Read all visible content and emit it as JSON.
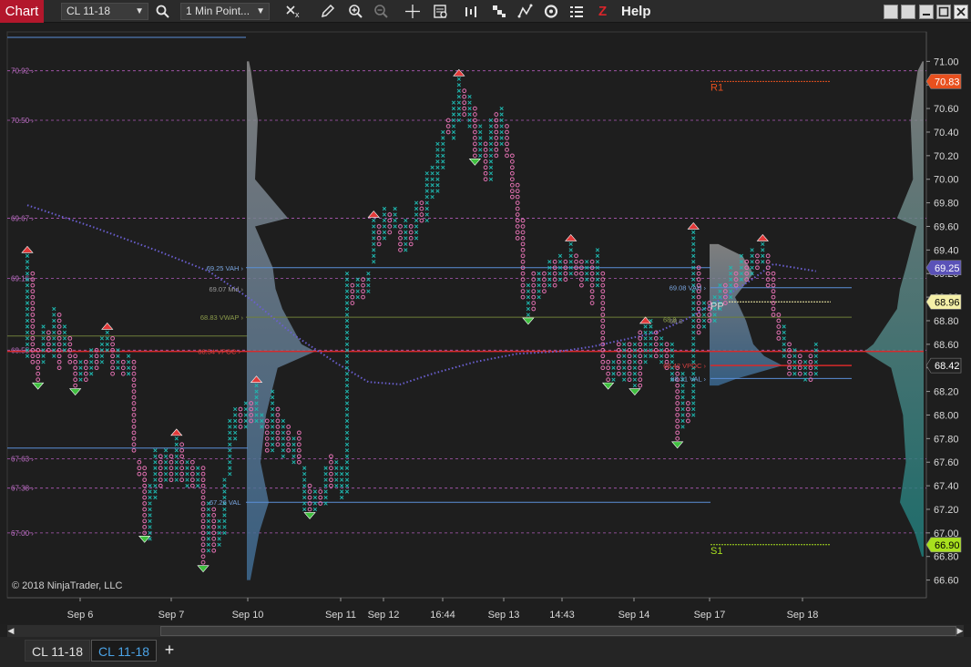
{
  "toolbar": {
    "chart_tab": "Chart",
    "instrument": "CL 11-18",
    "interval": "1 Min Point...",
    "help_z": "Z",
    "help": "Help"
  },
  "icons": [
    "search-icon",
    "data-series-icon",
    "pencil-icon",
    "zoom-in-icon",
    "zoom-out-icon",
    "crosshair-icon",
    "properties-icon",
    "bar-type-icon",
    "chart-style-icon",
    "drawing-tool-icon",
    "refresh-icon",
    "strategies-icon"
  ],
  "copyright": "© 2018 NinjaTrader, LLC",
  "tabs": [
    "CL 11-18",
    "CL 11-18"
  ],
  "add_tab": "+",
  "colors": {
    "up_x": "#1fb8b0",
    "down_o": "#e070b0",
    "vwap": "#6a5fd0",
    "value_line": "#5b8fd8",
    "poc": "#d82a2a",
    "pivot_dash": "#b05ab8",
    "r1": "#e8501e",
    "s1": "#a8e01e"
  },
  "chart_data": {
    "type": "point-and-figure",
    "instrument": "CL 11-18",
    "y_axis": {
      "range": [
        66.45,
        71.25
      ],
      "ticks": [
        "71.00",
        "70.80",
        "70.60",
        "70.40",
        "70.20",
        "70.00",
        "69.80",
        "69.60",
        "69.40",
        "69.20",
        "69.00",
        "68.80",
        "68.60",
        "68.40",
        "68.20",
        "68.00",
        "67.80",
        "67.60",
        "67.40",
        "67.20",
        "67.00",
        "66.80",
        "66.60"
      ]
    },
    "x_axis_labels": [
      "Sep 6",
      "Sep 7",
      "Sep 10",
      "Sep 11",
      "Sep 12",
      "16:44",
      "Sep 13",
      "14:43",
      "Sep 14",
      "Sep 17",
      "Sep 18"
    ],
    "price_markers": [
      {
        "label": "70.83",
        "value": 70.83,
        "bg": "#e8501e",
        "fg": "#ffffff"
      },
      {
        "label": "69.25",
        "value": 69.25,
        "bg": "#5a52b8",
        "fg": "#ffffff"
      },
      {
        "label": "68.96",
        "value": 68.96,
        "bg": "#f5f0a8",
        "fg": "#000000"
      },
      {
        "label": "68.42",
        "value": 68.42,
        "bg": "#202020",
        "fg": "#ffffff"
      },
      {
        "label": "66.90",
        "value": 66.9,
        "bg": "#a8e01e",
        "fg": "#000000"
      }
    ],
    "pivot_levels": [
      {
        "label": "70.92",
        "value": 70.92
      },
      {
        "label": "70.50",
        "value": 70.5
      },
      {
        "label": "69.67",
        "value": 69.67
      },
      {
        "label": "69.16",
        "value": 69.16
      },
      {
        "label": "68.55",
        "value": 68.55
      },
      {
        "label": "67.63",
        "value": 67.63
      },
      {
        "label": "67.38",
        "value": 67.38
      },
      {
        "label": "67.00",
        "value": 67.0
      }
    ],
    "pivot_tags": [
      {
        "label": "R1",
        "value": 70.83
      },
      {
        "label": "PP",
        "value": 68.96
      },
      {
        "label": "S1",
        "value": 66.9
      }
    ],
    "profile_labels": [
      {
        "label": "69.25 VAH",
        "value": 69.25
      },
      {
        "label": "69.07 Mid",
        "value": 69.07
      },
      {
        "label": "68.83 VWAP",
        "value": 68.83
      },
      {
        "label": "68.54 VPOC",
        "value": 68.54
      },
      {
        "label": "67.26 VAL",
        "value": 67.26
      },
      {
        "label": "69.08 VAH",
        "value": 69.08
      },
      {
        "label": "68.8",
        "value": 68.8
      },
      {
        "label": "68.8",
        "value": 68.81
      },
      {
        "label": "68.42 VPOC",
        "value": 68.42
      },
      {
        "label": "68.31 VAL",
        "value": 68.31
      }
    ],
    "pnf_columns": [
      [
        0,
        "X",
        68.5,
        69.35
      ],
      [
        1,
        "O",
        68.45,
        69.2
      ],
      [
        2,
        "O",
        68.3,
        68.55
      ],
      [
        3,
        "X",
        68.45,
        68.75
      ],
      [
        4,
        "O",
        68.55,
        68.7
      ],
      [
        5,
        "X",
        68.5,
        68.9
      ],
      [
        6,
        "O",
        68.4,
        68.85
      ],
      [
        7,
        "X",
        68.55,
        68.75
      ],
      [
        8,
        "O",
        68.45,
        68.65
      ],
      [
        9,
        "O",
        68.25,
        68.5
      ],
      [
        10,
        "X",
        68.3,
        68.45
      ],
      [
        11,
        "O",
        68.3,
        68.45
      ],
      [
        12,
        "X",
        68.35,
        68.55
      ],
      [
        13,
        "O",
        68.4,
        68.55
      ],
      [
        14,
        "X",
        68.45,
        68.65
      ],
      [
        15,
        "X",
        68.55,
        68.7
      ],
      [
        16,
        "O",
        68.35,
        68.65
      ],
      [
        17,
        "X",
        68.4,
        68.55
      ],
      [
        18,
        "O",
        68.35,
        68.45
      ],
      [
        19,
        "X",
        68.35,
        68.5
      ],
      [
        20,
        "O",
        67.7,
        68.45
      ],
      [
        21,
        "O",
        67.5,
        67.6
      ],
      [
        22,
        "O",
        67.0,
        67.55
      ],
      [
        23,
        "X",
        66.95,
        67.4
      ],
      [
        24,
        "X",
        67.3,
        67.7
      ],
      [
        25,
        "O",
        67.4,
        67.65
      ],
      [
        26,
        "X",
        67.45,
        67.7
      ],
      [
        27,
        "O",
        67.45,
        67.65
      ],
      [
        28,
        "X",
        67.45,
        67.8
      ],
      [
        29,
        "O",
        67.45,
        67.75
      ],
      [
        30,
        "X",
        67.4,
        67.6
      ],
      [
        31,
        "O",
        67.4,
        67.6
      ],
      [
        32,
        "X",
        67.4,
        67.55
      ],
      [
        33,
        "O",
        66.75,
        67.55
      ],
      [
        34,
        "X",
        66.85,
        67.25
      ],
      [
        35,
        "O",
        66.85,
        67.2
      ],
      [
        36,
        "X",
        66.9,
        67.1
      ],
      [
        37,
        "X",
        67.0,
        67.45
      ],
      [
        38,
        "X",
        67.5,
        67.95
      ],
      [
        39,
        "X",
        67.8,
        68.05
      ],
      [
        40,
        "O",
        67.9,
        68.05
      ],
      [
        41,
        "X",
        67.9,
        68.1
      ],
      [
        42,
        "O",
        67.95,
        68.1
      ],
      [
        43,
        "X",
        67.95,
        68.25
      ],
      [
        44,
        "X",
        67.9,
        68.0
      ],
      [
        45,
        "O",
        67.7,
        67.95
      ],
      [
        46,
        "X",
        67.7,
        68.2
      ],
      [
        47,
        "O",
        67.75,
        68.05
      ],
      [
        48,
        "X",
        67.65,
        67.95
      ],
      [
        49,
        "O",
        67.7,
        67.9
      ],
      [
        50,
        "X",
        67.6,
        67.8
      ],
      [
        51,
        "O",
        67.6,
        67.85
      ],
      [
        52,
        "X",
        67.2,
        67.55
      ],
      [
        53,
        "O",
        67.2,
        67.4
      ],
      [
        54,
        "X",
        67.2,
        67.35
      ],
      [
        55,
        "O",
        67.25,
        67.35
      ],
      [
        56,
        "X",
        67.25,
        67.55
      ],
      [
        57,
        "O",
        67.4,
        67.65
      ],
      [
        58,
        "X",
        67.4,
        67.6
      ],
      [
        59,
        "X",
        67.3,
        67.55
      ],
      [
        60,
        "X",
        67.35,
        69.2
      ],
      [
        61,
        "O",
        68.95,
        69.1
      ],
      [
        62,
        "X",
        69.0,
        69.15
      ],
      [
        63,
        "O",
        69.0,
        69.15
      ],
      [
        64,
        "X",
        69.05,
        69.2
      ],
      [
        65,
        "X",
        69.3,
        69.65
      ],
      [
        66,
        "O",
        69.45,
        69.6
      ],
      [
        67,
        "X",
        69.5,
        69.75
      ],
      [
        68,
        "O",
        69.55,
        69.7
      ],
      [
        69,
        "X",
        69.6,
        69.75
      ],
      [
        70,
        "O",
        69.4,
        69.6
      ],
      [
        71,
        "X",
        69.4,
        69.65
      ],
      [
        72,
        "O",
        69.45,
        69.6
      ],
      [
        73,
        "X",
        69.5,
        69.8
      ],
      [
        74,
        "O",
        69.65,
        69.8
      ],
      [
        75,
        "X",
        69.65,
        70.05
      ],
      [
        76,
        "X",
        69.85,
        70.1
      ],
      [
        77,
        "X",
        69.9,
        70.3
      ],
      [
        78,
        "X",
        70.1,
        70.4
      ],
      [
        79,
        "O",
        70.4,
        70.5
      ],
      [
        80,
        "X",
        70.35,
        70.65
      ],
      [
        81,
        "X",
        70.5,
        70.85
      ],
      [
        82,
        "O",
        70.55,
        70.75
      ],
      [
        83,
        "X",
        70.45,
        70.7
      ],
      [
        84,
        "O",
        70.2,
        70.6
      ],
      [
        85,
        "X",
        70.2,
        70.45
      ],
      [
        86,
        "O",
        70.0,
        70.3
      ],
      [
        87,
        "X",
        70.0,
        70.5
      ],
      [
        88,
        "O",
        70.2,
        70.55
      ],
      [
        89,
        "X",
        70.3,
        70.6
      ],
      [
        90,
        "O",
        70.2,
        70.45
      ],
      [
        91,
        "O",
        69.85,
        70.2
      ],
      [
        92,
        "O",
        69.5,
        69.95
      ],
      [
        93,
        "O",
        69.0,
        69.65
      ],
      [
        94,
        "X",
        68.85,
        69.1
      ],
      [
        95,
        "O",
        68.9,
        69.2
      ],
      [
        96,
        "X",
        69.0,
        69.2
      ],
      [
        97,
        "O",
        69.05,
        69.2
      ],
      [
        98,
        "X",
        69.1,
        69.3
      ],
      [
        99,
        "O",
        69.1,
        69.3
      ],
      [
        100,
        "X",
        69.15,
        69.35
      ],
      [
        101,
        "O",
        69.15,
        69.3
      ],
      [
        102,
        "X",
        69.2,
        69.45
      ],
      [
        103,
        "O",
        69.2,
        69.35
      ],
      [
        104,
        "O",
        69.1,
        69.3
      ],
      [
        105,
        "X",
        69.15,
        69.3
      ],
      [
        106,
        "O",
        68.95,
        69.3
      ],
      [
        107,
        "X",
        69.1,
        69.4
      ],
      [
        108,
        "O",
        68.4,
        69.2
      ],
      [
        109,
        "O",
        68.3,
        68.45
      ],
      [
        110,
        "X",
        68.3,
        68.45
      ],
      [
        111,
        "O",
        68.35,
        68.6
      ],
      [
        112,
        "X",
        68.3,
        68.6
      ],
      [
        113,
        "O",
        68.3,
        68.6
      ],
      [
        114,
        "X",
        68.25,
        68.6
      ],
      [
        115,
        "O",
        68.25,
        68.7
      ],
      [
        116,
        "X",
        68.45,
        68.75
      ],
      [
        117,
        "X",
        68.5,
        68.8
      ],
      [
        118,
        "O",
        68.5,
        68.7
      ],
      [
        119,
        "X",
        68.45,
        68.65
      ],
      [
        120,
        "O",
        68.4,
        68.6
      ],
      [
        121,
        "X",
        68.3,
        68.6
      ],
      [
        122,
        "O",
        67.8,
        68.4
      ],
      [
        123,
        "X",
        67.9,
        68.35
      ],
      [
        124,
        "O",
        67.95,
        68.1
      ],
      [
        125,
        "X",
        68.0,
        69.55
      ],
      [
        126,
        "O",
        68.7,
        69.25
      ],
      [
        127,
        "X",
        68.75,
        68.95
      ],
      [
        128,
        "O",
        68.8,
        68.95
      ],
      [
        129,
        "X",
        68.8,
        69.0
      ],
      [
        130,
        "X",
        68.9,
        69.1
      ],
      [
        131,
        "O",
        68.95,
        69.1
      ],
      [
        132,
        "X",
        69.0,
        69.25
      ],
      [
        133,
        "O",
        69.1,
        69.2
      ],
      [
        134,
        "X",
        69.15,
        69.35
      ],
      [
        135,
        "O",
        69.15,
        69.3
      ],
      [
        136,
        "X",
        69.2,
        69.4
      ],
      [
        137,
        "O",
        69.25,
        69.35
      ],
      [
        138,
        "X",
        69.3,
        69.45
      ],
      [
        139,
        "O",
        69.1,
        69.35
      ],
      [
        140,
        "O",
        68.85,
        69.2
      ],
      [
        141,
        "O",
        68.65,
        68.85
      ],
      [
        142,
        "X",
        68.5,
        68.75
      ],
      [
        143,
        "O",
        68.35,
        68.6
      ],
      [
        144,
        "X",
        68.35,
        68.55
      ],
      [
        145,
        "O",
        68.35,
        68.5
      ],
      [
        146,
        "X",
        68.3,
        68.45
      ],
      [
        147,
        "O",
        68.3,
        68.5
      ],
      [
        148,
        "X",
        68.35,
        68.6
      ]
    ],
    "reversal_arrows": [
      [
        0,
        "up",
        69.4
      ],
      [
        2,
        "down",
        68.25
      ],
      [
        9,
        "down",
        68.2
      ],
      [
        15,
        "up",
        68.75
      ],
      [
        22,
        "down",
        66.95
      ],
      [
        28,
        "up",
        67.85
      ],
      [
        33,
        "down",
        66.7
      ],
      [
        43,
        "up",
        68.3
      ],
      [
        53,
        "down",
        67.15
      ],
      [
        65,
        "up",
        69.7
      ],
      [
        81,
        "up",
        70.9
      ],
      [
        84,
        "down",
        70.15
      ],
      [
        94,
        "down",
        68.8
      ],
      [
        102,
        "up",
        69.5
      ],
      [
        109,
        "down",
        68.25
      ],
      [
        114,
        "down",
        68.2
      ],
      [
        116,
        "up",
        68.8
      ],
      [
        122,
        "down",
        67.75
      ],
      [
        125,
        "up",
        69.6
      ],
      [
        138,
        "up",
        69.5
      ]
    ],
    "vwap_points": [
      [
        0,
        69.78
      ],
      [
        12,
        69.6
      ],
      [
        24,
        69.4
      ],
      [
        34,
        69.22
      ],
      [
        42,
        68.98
      ],
      [
        50,
        68.68
      ],
      [
        58,
        68.44
      ],
      [
        64,
        68.28
      ],
      [
        70,
        68.26
      ],
      [
        76,
        68.35
      ],
      [
        84,
        68.45
      ],
      [
        92,
        68.52
      ],
      [
        100,
        68.54
      ],
      [
        106,
        68.58
      ],
      [
        112,
        68.64
      ],
      [
        118,
        68.7
      ],
      [
        124,
        68.82
      ],
      [
        130,
        68.98
      ],
      [
        136,
        69.15
      ],
      [
        140,
        69.28
      ],
      [
        148,
        69.22
      ]
    ],
    "volume_profiles": [
      {
        "session": 1,
        "levels": [
          66.6,
          67.0,
          67.26,
          67.6,
          68.0,
          68.4,
          68.54,
          68.6,
          68.9,
          69.07,
          69.25,
          69.6,
          69.67,
          70.0,
          70.5,
          70.92,
          71.0
        ],
        "volumes": [
          0.05,
          0.18,
          0.32,
          0.2,
          0.28,
          0.45,
          1.0,
          0.8,
          0.52,
          0.42,
          0.38,
          0.12,
          0.6,
          0.12,
          0.16,
          0.06,
          0.03
        ]
      },
      {
        "session": 2,
        "levels": [
          68.25,
          68.31,
          68.42,
          68.5,
          68.6,
          68.8,
          69.0,
          69.08,
          69.2,
          69.35,
          69.45
        ],
        "volumes": [
          0.12,
          0.38,
          1.0,
          0.75,
          0.6,
          0.5,
          0.35,
          0.45,
          0.6,
          0.45,
          0.12
        ]
      },
      {
        "session": "right",
        "levels": [
          66.8,
          67.0,
          67.26,
          67.6,
          68.0,
          68.4,
          68.54,
          68.6,
          68.9,
          69.07,
          69.25,
          69.6,
          69.67,
          70.0,
          70.5,
          70.92,
          71.0
        ],
        "volumes": [
          0.03,
          0.15,
          0.4,
          0.3,
          0.35,
          0.55,
          1.0,
          0.85,
          0.45,
          0.4,
          0.3,
          0.12,
          0.45,
          0.18,
          0.22,
          0.1,
          0.02
        ]
      }
    ]
  }
}
